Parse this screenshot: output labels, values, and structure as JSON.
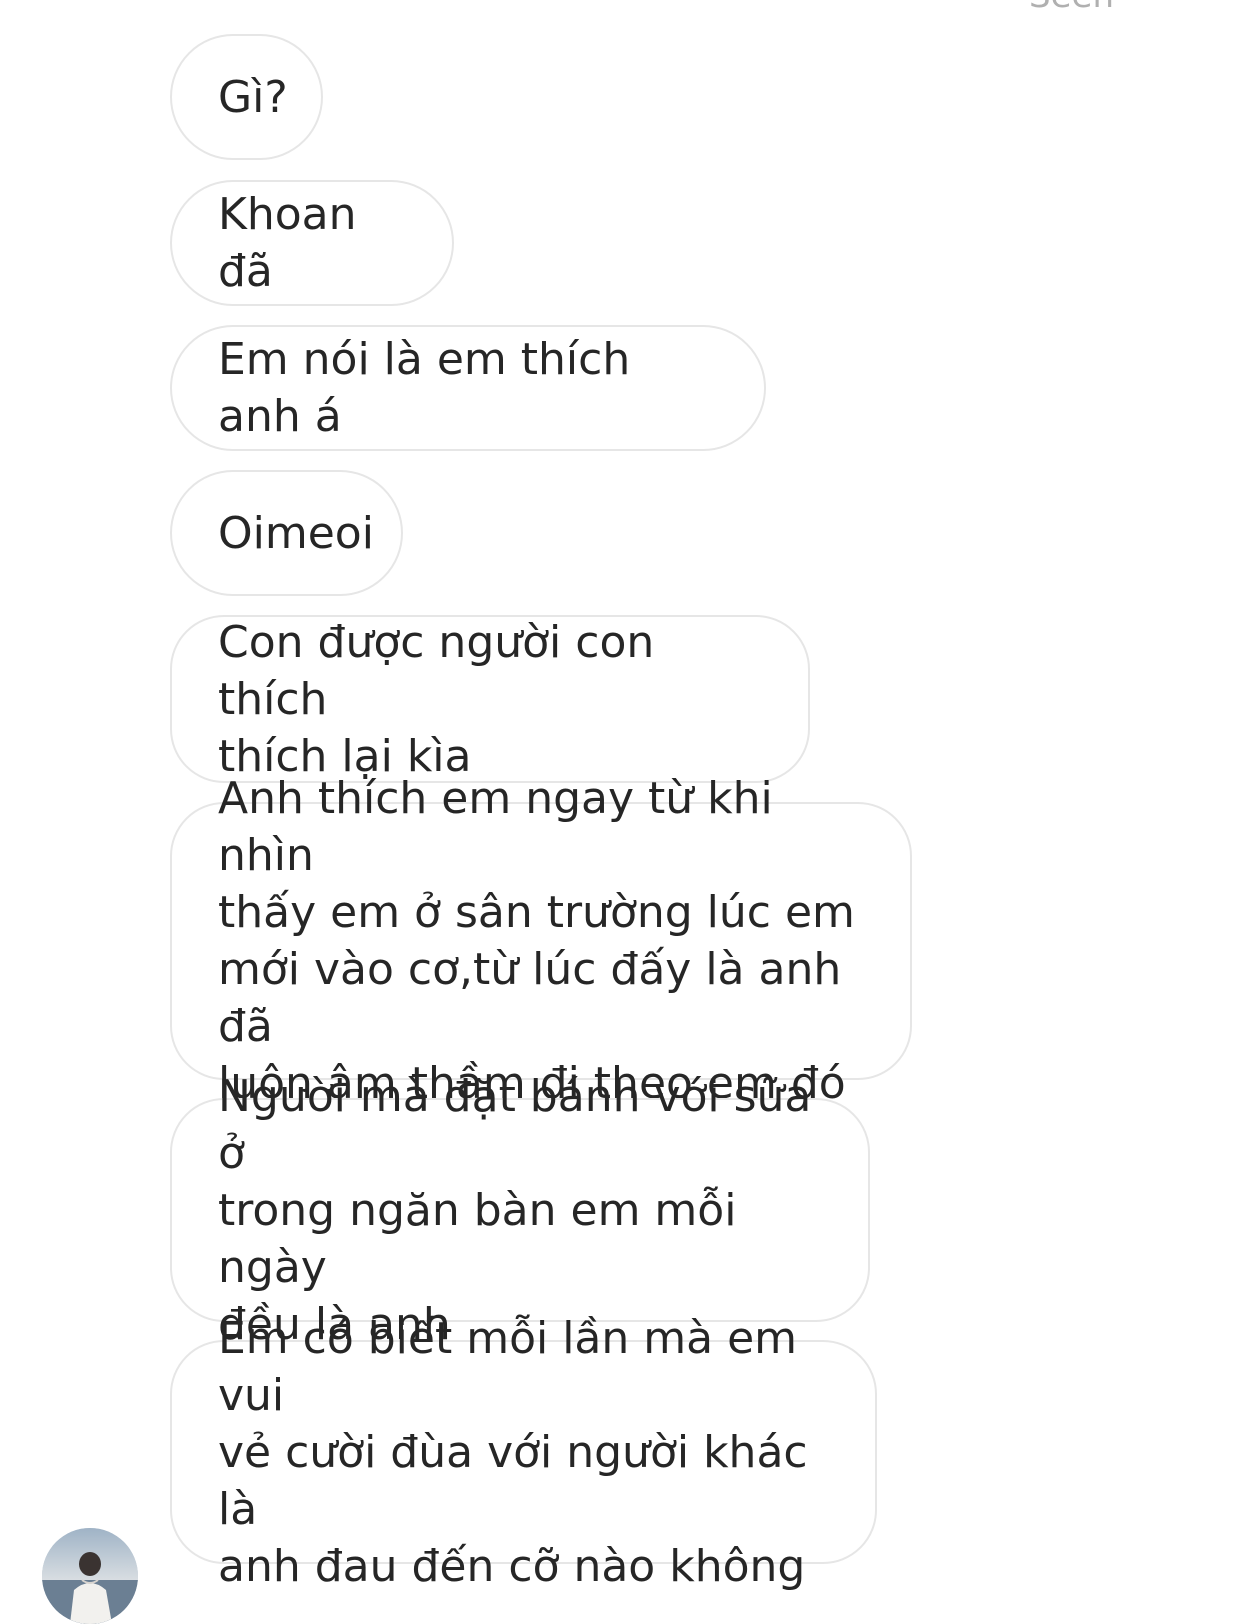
{
  "header": {
    "seen_label": "Seen"
  },
  "messages": [
    {
      "text": "Gì?"
    },
    {
      "text": "Khoan đã"
    },
    {
      "text": "Em nói là em thích anh á"
    },
    {
      "text": "Oimeoi"
    },
    {
      "text": "Con được người con thích\nthích lại kìa"
    },
    {
      "text": "Anh thích em ngay từ khi nhìn\nthấy em ở sân trường lúc em\nmới vào cơ,từ lúc đấy là anh đã\nluôn âm thầm đi theo em đó"
    },
    {
      "text": "Người mà đặt bánh với sữa ở\ntrong ngăn bàn em mỗi ngày\nđều là anh"
    },
    {
      "text": "Em có biết mỗi lần mà em vui\nvẻ cười đùa với người khác là\nanh đau đến cỡ nào không"
    }
  ],
  "colors": {
    "bubble_border": "#e6e6e6",
    "text": "#262626",
    "seen": "#b0b0b0"
  },
  "icons": {
    "avatar": "sender-avatar-photo"
  }
}
